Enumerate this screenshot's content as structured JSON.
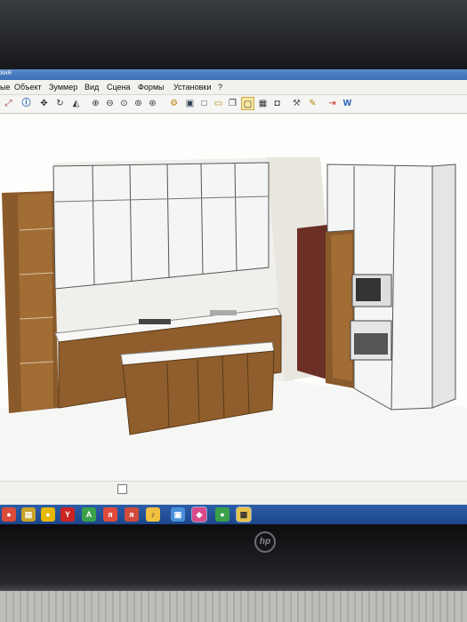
{
  "window": {
    "title": "хня"
  },
  "menu": {
    "items": [
      "ые",
      "Объект",
      "Зуммер",
      "Вид",
      "Сцена",
      "Формы",
      "Установки",
      "?"
    ]
  },
  "toolbar": {
    "icons": [
      "save-icon",
      "info-icon",
      "move-icon",
      "rotate-icon",
      "triangle-icon",
      "zoom-in-icon",
      "zoom-out-icon",
      "zoom-window-icon",
      "zoom-all-icon",
      "zoom-fit-icon",
      "render-icon",
      "floppy-icon",
      "box-icon",
      "frame-icon",
      "copy-icon",
      "select-box-icon",
      "camera-icon",
      "camera2-icon",
      "tools-icon",
      "paint-icon",
      "arrow-icon",
      "w-icon"
    ]
  },
  "taskbar": {
    "apps": [
      "chrome",
      "explorer",
      "media",
      "yandex",
      "android",
      "yandex-doc",
      "yandex-alt",
      "files",
      "monitor",
      "paint",
      "chrome-alt",
      "kitchen-app"
    ]
  },
  "colors": {
    "wood": "#8a5a2a",
    "cabinet": "#f4f5f5",
    "door": "#6b2f26",
    "taskbar": "#1f4d92"
  }
}
